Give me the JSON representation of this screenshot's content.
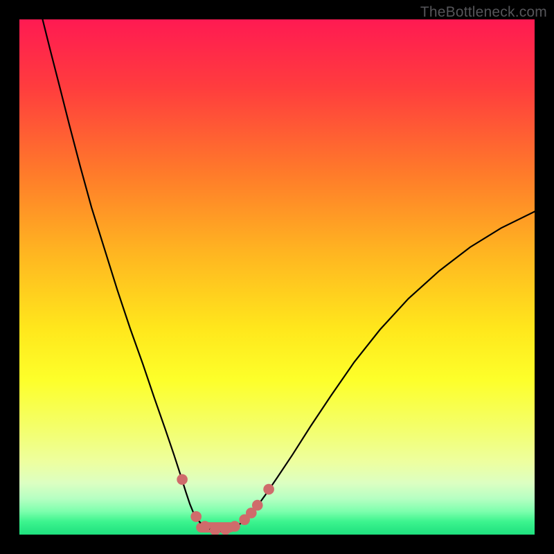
{
  "watermark": "TheBottleneck.com",
  "chart_data": {
    "type": "line",
    "title": "",
    "xlabel": "",
    "ylabel": "",
    "xlim": [
      0,
      1
    ],
    "ylim": [
      0,
      1
    ],
    "gradient_stops": [
      {
        "offset": 0.0,
        "color": "#ff1a52"
      },
      {
        "offset": 0.13,
        "color": "#ff3c3e"
      },
      {
        "offset": 0.3,
        "color": "#ff7b2a"
      },
      {
        "offset": 0.45,
        "color": "#ffb421"
      },
      {
        "offset": 0.6,
        "color": "#ffe71c"
      },
      {
        "offset": 0.7,
        "color": "#fdff2a"
      },
      {
        "offset": 0.8,
        "color": "#f3ff70"
      },
      {
        "offset": 0.86,
        "color": "#edffa0"
      },
      {
        "offset": 0.9,
        "color": "#dcffc2"
      },
      {
        "offset": 0.93,
        "color": "#b6ffc2"
      },
      {
        "offset": 0.955,
        "color": "#7dffad"
      },
      {
        "offset": 0.975,
        "color": "#3cf48e"
      },
      {
        "offset": 1.0,
        "color": "#1ee07e"
      }
    ],
    "series": [
      {
        "name": "left-curve",
        "stroke": "#000000",
        "stroke_width": 2.2,
        "points": [
          {
            "x": 0.045,
            "y": 1.0
          },
          {
            "x": 0.06,
            "y": 0.94
          },
          {
            "x": 0.078,
            "y": 0.87
          },
          {
            "x": 0.097,
            "y": 0.795
          },
          {
            "x": 0.118,
            "y": 0.715
          },
          {
            "x": 0.14,
            "y": 0.635
          },
          {
            "x": 0.165,
            "y": 0.555
          },
          {
            "x": 0.19,
            "y": 0.475
          },
          {
            "x": 0.215,
            "y": 0.4
          },
          {
            "x": 0.24,
            "y": 0.33
          },
          {
            "x": 0.262,
            "y": 0.265
          },
          {
            "x": 0.283,
            "y": 0.205
          },
          {
            "x": 0.3,
            "y": 0.155
          },
          {
            "x": 0.313,
            "y": 0.115
          },
          {
            "x": 0.323,
            "y": 0.083
          },
          {
            "x": 0.331,
            "y": 0.059
          },
          {
            "x": 0.338,
            "y": 0.042
          },
          {
            "x": 0.346,
            "y": 0.029
          },
          {
            "x": 0.354,
            "y": 0.02
          },
          {
            "x": 0.364,
            "y": 0.013
          },
          {
            "x": 0.376,
            "y": 0.009
          },
          {
            "x": 0.39,
            "y": 0.007
          }
        ]
      },
      {
        "name": "right-curve",
        "stroke": "#000000",
        "stroke_width": 2.2,
        "points": [
          {
            "x": 0.39,
            "y": 0.007
          },
          {
            "x": 0.404,
            "y": 0.009
          },
          {
            "x": 0.417,
            "y": 0.014
          },
          {
            "x": 0.43,
            "y": 0.022
          },
          {
            "x": 0.443,
            "y": 0.033
          },
          {
            "x": 0.458,
            "y": 0.05
          },
          {
            "x": 0.476,
            "y": 0.075
          },
          {
            "x": 0.5,
            "y": 0.11
          },
          {
            "x": 0.53,
            "y": 0.155
          },
          {
            "x": 0.565,
            "y": 0.21
          },
          {
            "x": 0.605,
            "y": 0.27
          },
          {
            "x": 0.65,
            "y": 0.335
          },
          {
            "x": 0.7,
            "y": 0.398
          },
          {
            "x": 0.755,
            "y": 0.458
          },
          {
            "x": 0.815,
            "y": 0.512
          },
          {
            "x": 0.875,
            "y": 0.558
          },
          {
            "x": 0.935,
            "y": 0.595
          },
          {
            "x": 1.0,
            "y": 0.627
          }
        ]
      }
    ],
    "markers": {
      "color": "#cf6b6b",
      "radius_norm": 0.0105,
      "points": [
        {
          "x": 0.316,
          "y": 0.107
        },
        {
          "x": 0.343,
          "y": 0.035
        },
        {
          "x": 0.36,
          "y": 0.016
        },
        {
          "x": 0.38,
          "y": 0.009
        },
        {
          "x": 0.4,
          "y": 0.01
        },
        {
          "x": 0.418,
          "y": 0.016
        },
        {
          "x": 0.437,
          "y": 0.029
        },
        {
          "x": 0.45,
          "y": 0.042
        },
        {
          "x": 0.462,
          "y": 0.057
        },
        {
          "x": 0.484,
          "y": 0.088
        }
      ],
      "bar": {
        "x1": 0.343,
        "x2": 0.418,
        "y": 0.014,
        "h": 0.02
      }
    }
  }
}
